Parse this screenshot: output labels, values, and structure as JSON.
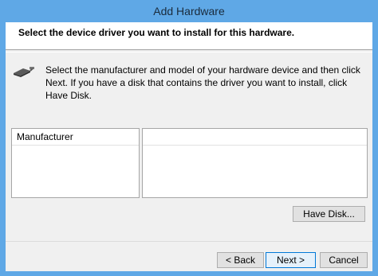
{
  "window": {
    "title": "Add Hardware"
  },
  "header": {
    "title": "Select the device driver you want to install for this hardware."
  },
  "description": {
    "text": "Select the manufacturer and model of your hardware device and then click Next. If you have a disk that contains the driver you want to install, click Have Disk."
  },
  "lists": {
    "manufacturer_header": "Manufacturer"
  },
  "buttons": {
    "have_disk": "Have Disk...",
    "back": "< Back",
    "next": "Next >",
    "cancel": "Cancel"
  },
  "icons": {
    "device": "hardware-device-icon"
  },
  "colors": {
    "titlebar": "#5fa8e6",
    "client": "#f0f0f0",
    "header_band": "#ffffff"
  }
}
